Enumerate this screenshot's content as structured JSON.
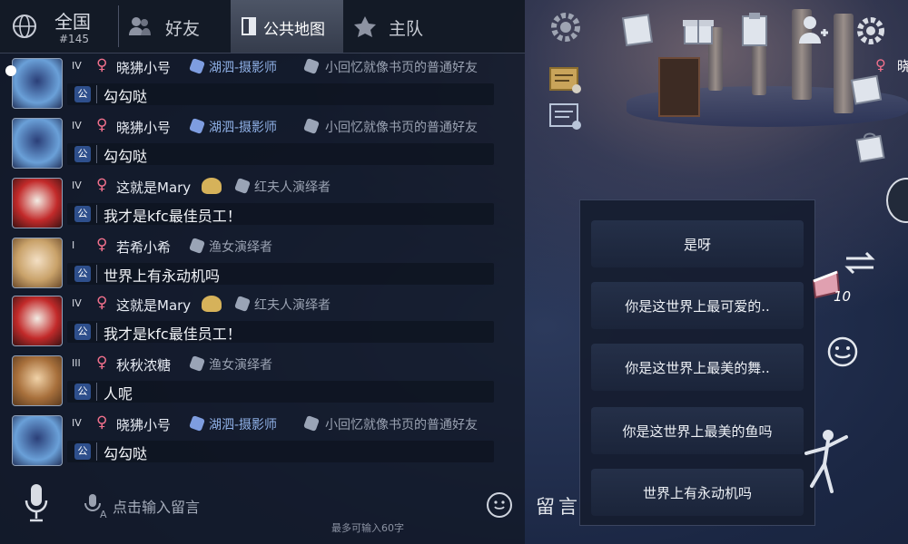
{
  "tabs": {
    "national": {
      "label": "全国",
      "sub": "#145"
    },
    "friends": {
      "label": "好友"
    },
    "public_map": {
      "label": "公共地图"
    },
    "team": {
      "label": "主队"
    }
  },
  "messages": [
    {
      "rank": "IV",
      "name": "晓狒小号",
      "title": "湖泗-摄影师",
      "title2": "小回忆就像书页的普通好友",
      "text": "勾勾哒",
      "avatar": "blue"
    },
    {
      "rank": "IV",
      "name": "晓狒小号",
      "title": "湖泗-摄影师",
      "title2": "小回忆就像书页的普通好友",
      "text": "勾勾哒",
      "avatar": "blue"
    },
    {
      "rank": "IV",
      "name": "这就是Mary",
      "title": "",
      "title2": "红夫人演绎者",
      "text": "我才是kfc最佳员工！",
      "avatar": "red"
    },
    {
      "rank": "I",
      "name": "若希小希",
      "title": "",
      "title2": "渔女演绎者",
      "text": "世界上有永动机吗",
      "avatar": "blonde"
    },
    {
      "rank": "IV",
      "name": "这就是Mary",
      "title": "",
      "title2": "红夫人演绎者",
      "text": "我才是kfc最佳员工！",
      "avatar": "red"
    },
    {
      "rank": "III",
      "name": "秋秋浓糖",
      "title": "",
      "title2": "渔女演绎者",
      "text": "人呢",
      "avatar": "brown"
    },
    {
      "rank": "IV",
      "name": "晓狒小号",
      "title": "湖泗-摄影师",
      "title2": "小回忆就像书页的普通好友",
      "text": "勾勾哒",
      "avatar": "blue"
    }
  ],
  "channel_badge": "公",
  "input": {
    "placeholder": "点击输入留言",
    "limit": "最多可输入60字"
  },
  "post_button": "留言",
  "quick_replies": [
    "是呀",
    "你是这世界上最可爱的..",
    "你是这世界上最美的舞..",
    "你是这世界上最美的鱼吗",
    "世界上有永动机吗"
  ],
  "item_count": "10",
  "right_name": "晓"
}
